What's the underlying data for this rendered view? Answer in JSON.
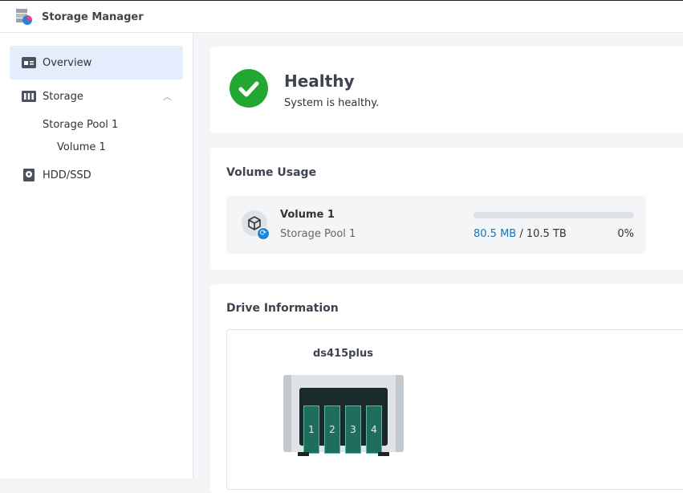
{
  "app": {
    "title": "Storage Manager"
  },
  "sidebar": {
    "items": [
      {
        "label": "Overview",
        "icon": "overview-icon"
      },
      {
        "label": "Storage",
        "icon": "storage-icon"
      },
      {
        "label": "HDD/SSD",
        "icon": "hdd-icon"
      }
    ],
    "storage_pool": "Storage Pool 1",
    "volume": "Volume 1"
  },
  "health": {
    "status": "Healthy",
    "message": "System is healthy.",
    "color": "#22a733"
  },
  "volume_usage": {
    "heading": "Volume Usage",
    "name": "Volume 1",
    "pool": "Storage Pool 1",
    "used": "80.5 MB",
    "separator": " / ",
    "total": "10.5 TB",
    "percent_label": "0%",
    "percent": 0
  },
  "drive_info": {
    "heading": "Drive Information",
    "device": "ds415plus",
    "bays": [
      "1",
      "2",
      "3",
      "4"
    ]
  }
}
